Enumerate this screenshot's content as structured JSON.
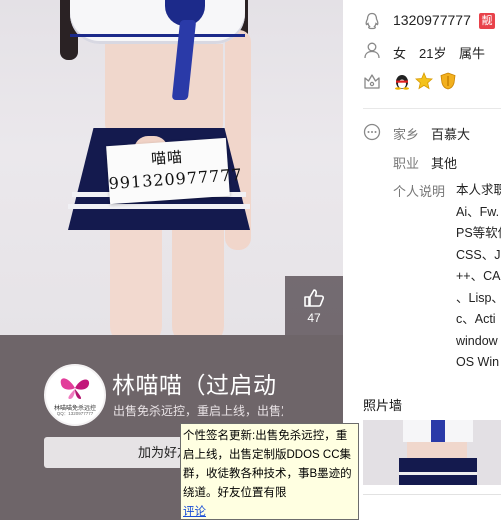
{
  "profile_card": {
    "photo_sign": {
      "line1": "喵喵",
      "line2": "991320977777"
    },
    "like": {
      "icon": "thumbs-up-icon",
      "count": "47"
    },
    "avatar_logo": {
      "line1": "林喵喵免杀远控",
      "line2": "QQ：1320977777"
    },
    "nickname": "林喵喵（过启动",
    "signature": "出售免杀远控，重启上线，出售定制版",
    "add_button_label": "加为好友"
  },
  "tooltip": {
    "text": "个性签名更新:出售免杀远控，重启上线，出售定制版DDOS CC集群，收徒教各种技术，事B墨迹的绕道。好友位置有限",
    "comment_link": "评论"
  },
  "side_info": {
    "qq_number": "1320977777",
    "qq_badge": "靓",
    "gender": "女",
    "age": "21岁",
    "zodiac": "属牛",
    "hometown_label": "家乡",
    "hometown_value": "百慕大",
    "job_label": "职业",
    "job_value": "其他",
    "desc_label": "个人说明",
    "desc_lines": [
      "本人求职",
      "Ai、Fw.",
      "PS等软件",
      "CSS、JS",
      "++、CA",
      "、Lisp、",
      "c、Acti",
      "window",
      "OS Win"
    ],
    "photo_wall_title": "照片墙"
  },
  "colors": {
    "info_band": "#6e6569",
    "tooltip_bg": "#ffffe1",
    "badge_red": "#e8424a",
    "link_blue": "#1a4fd6"
  }
}
